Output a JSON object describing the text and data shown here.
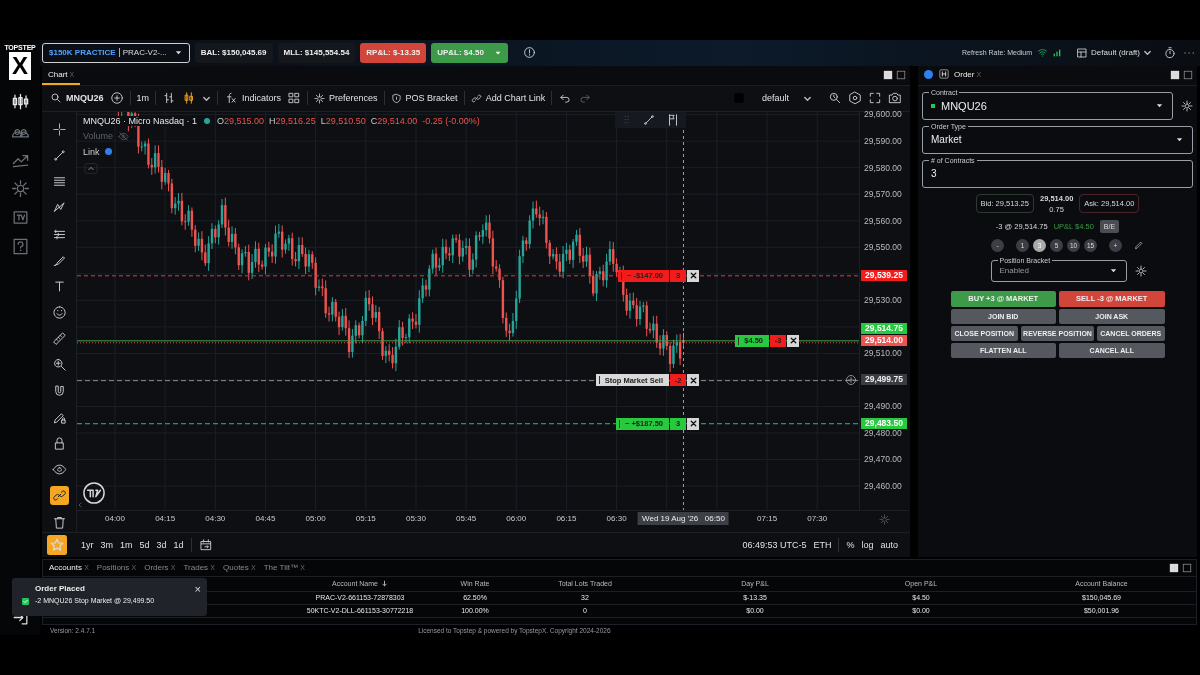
{
  "logo": {
    "wordmark": "TOPSTEP",
    "mark": "X"
  },
  "app_nav": [
    {
      "kind": "chart",
      "selected": true
    },
    {
      "kind": "people",
      "selected": false
    },
    {
      "kind": "trend",
      "selected": false
    },
    {
      "kind": "gear",
      "selected": false
    },
    {
      "kind": "tv",
      "selected": false
    },
    {
      "kind": "help",
      "selected": false
    }
  ],
  "header": {
    "account": {
      "name": "$150K PRACTICE",
      "id": "PRAC-V2-..."
    },
    "stats": [
      {
        "text": "BAL: $150,045.69",
        "kind": "neutral"
      },
      {
        "text": "MLL: $145,554.54",
        "kind": "neutral"
      },
      {
        "text": "RP&L: $-13.35",
        "kind": "loss"
      },
      {
        "text": "UP&L: $4.50",
        "kind": "gain"
      }
    ],
    "refresh_rate": "Refresh Rate: Medium",
    "layout": "Default (draft)"
  },
  "chart_panel": {
    "tab": {
      "label": "Chart",
      "close": "X"
    },
    "toolbar": {
      "symbol": "MNQU26",
      "interval": "1m",
      "indicators": "Indicators",
      "preferences": "Preferences",
      "pos_bracket": "POS Bracket",
      "chart_link": "Add Chart Link",
      "template": "default"
    },
    "legend": {
      "title": "MNQU26 · Micro Nasdaq · 1",
      "ohlc": [
        {
          "key": "O",
          "value": "29,515.00"
        },
        {
          "key": "H",
          "value": "29,516.25"
        },
        {
          "key": "L",
          "value": "29,510.50"
        },
        {
          "key": "C",
          "value": "29,514.00"
        }
      ],
      "change": "-0.25 (-0.00%)",
      "volume": "Volume",
      "link": "Link"
    },
    "tools": [
      {
        "kind": "cross",
        "selected": true,
        "on": false
      },
      {
        "kind": "line",
        "selected": false,
        "on": false
      },
      {
        "kind": "fib",
        "selected": false,
        "on": false
      },
      {
        "kind": "pattern",
        "selected": false,
        "on": false
      },
      {
        "kind": "list",
        "selected": false,
        "on": false
      },
      {
        "kind": "brush",
        "selected": false,
        "on": false
      },
      {
        "kind": "text",
        "selected": false,
        "on": false
      },
      {
        "kind": "emoji",
        "selected": false,
        "on": false
      },
      {
        "kind": "ruler",
        "selected": false,
        "on": false
      },
      {
        "kind": "zoom",
        "selected": false,
        "on": false
      },
      {
        "kind": "magnet",
        "selected": false,
        "on": false
      },
      {
        "kind": "pencil-lock",
        "selected": false,
        "on": false
      },
      {
        "kind": "lock",
        "selected": false,
        "on": false
      },
      {
        "kind": "eye",
        "selected": false,
        "on": false
      },
      {
        "kind": "link",
        "selected": false,
        "on": true
      },
      {
        "kind": "trash",
        "selected": false,
        "on": false
      }
    ],
    "price_ticks": [
      "29,600.00",
      "29,590.00",
      "29,580.00",
      "29,570.00",
      "29,560.00",
      "29,550.00",
      "29,530.00",
      "29,510.00",
      "29,490.00",
      "29,480.00",
      "29,470.00",
      "29,460.00"
    ],
    "time_axis": [
      {
        "text": "04:00",
        "kind": "tick"
      },
      {
        "text": "04:15",
        "kind": "tick"
      },
      {
        "text": "04:30",
        "kind": "tick"
      },
      {
        "text": "04:45",
        "kind": "tick"
      },
      {
        "text": "05:00",
        "kind": "tick"
      },
      {
        "text": "05:15",
        "kind": "tick"
      },
      {
        "text": "05:30",
        "kind": "tick"
      },
      {
        "text": "05:45",
        "kind": "tick"
      },
      {
        "text": "06:00",
        "kind": "tick"
      },
      {
        "text": "06:15",
        "kind": "tick"
      },
      {
        "text": "06:30",
        "kind": "tick"
      },
      {
        "text": "Wed 19 Aug '26   06:50",
        "kind": "crosshair"
      },
      {
        "text": "07:15",
        "kind": "tick"
      },
      {
        "text": "07:30",
        "kind": "tick"
      }
    ],
    "order_lines": [
      {
        "kind": "loss",
        "label": "~ -$147.00",
        "qty": "3",
        "price": "29,539.25"
      },
      {
        "kind": "position",
        "label": "$4.50",
        "qty": "-3",
        "price": "29,514.75"
      },
      {
        "kind": "stop",
        "label": "Stop Market Sell",
        "qty": "-2",
        "price": "29,499.75"
      },
      {
        "kind": "profit",
        "label": "~ +$187.50",
        "qty": "3",
        "price": "29,483.50"
      }
    ],
    "last_price": "29,514.00",
    "ranges": [
      "1yr",
      "3m",
      "1m",
      "5d",
      "3d",
      "1d"
    ],
    "clock": "06:49:53 UTC-5",
    "session": "ETH",
    "scale_options": [
      "%",
      "log",
      "auto"
    ]
  },
  "order_panel": {
    "tab": {
      "label": "Order",
      "close": "X"
    },
    "contract": {
      "label": "Contract",
      "value": "MNQU26"
    },
    "order_type": {
      "label": "Order Type",
      "value": "Market"
    },
    "contracts": {
      "label": "# of Contracts",
      "value": "3"
    },
    "bid": "Bid: 29,513.25",
    "last": "29,514.00",
    "spread": "0.75",
    "ask": "Ask: 29,514.00",
    "position": "-3 @ 29,514.75",
    "upl": "UP&L $4.50",
    "breakeven": "B/E",
    "minus": "-",
    "plus": "+",
    "quantity_presets": [
      {
        "text": "1",
        "selected": false
      },
      {
        "text": "3",
        "selected": true
      },
      {
        "text": "5",
        "selected": false
      },
      {
        "text": "10",
        "selected": false
      },
      {
        "text": "15",
        "selected": false
      }
    ],
    "bracket": {
      "label": "Position Bracket",
      "value": "Enabled"
    },
    "buy": "BUY +3 @ MARKET",
    "sell": "SELL -3 @ MARKET",
    "actions": [
      [
        "JOIN BID",
        "JOIN ASK"
      ],
      [
        "CLOSE POSITION",
        "REVERSE POSITION",
        "CANCEL ORDERS"
      ],
      [
        "FLATTEN ALL",
        "CANCEL ALL"
      ]
    ]
  },
  "bottom_panel": {
    "tabs": [
      {
        "label": "Accounts",
        "close": "X",
        "selected": true
      },
      {
        "label": "Positions",
        "close": "X",
        "selected": false
      },
      {
        "label": "Orders",
        "close": "X",
        "selected": false
      },
      {
        "label": "Trades",
        "close": "X",
        "selected": false
      },
      {
        "label": "Quotes",
        "close": "X",
        "selected": false
      },
      {
        "label": "The Tilt™",
        "close": "X",
        "selected": false
      }
    ],
    "columns": [
      "Account Name",
      "Win Rate",
      "Total Lots Traded",
      "Day P&L",
      "Open P&L",
      "Account Balance"
    ],
    "rows": [
      [
        "PRAC-V2-661153-72878303",
        "62.50%",
        "32",
        "$-13.35",
        "$4.50",
        "$150,045.69"
      ],
      [
        "50KTC-V2-DLL-661153-30772218",
        "100.00%",
        "0",
        "$0.00",
        "$0.00",
        "$50,001.96"
      ]
    ]
  },
  "toast": {
    "title": "Order Placed",
    "message": "-2 MNQU26 Stop Market @ 29,499.50",
    "close": "×"
  },
  "footer": {
    "version": "Version: 2.4.7.1",
    "license": "Licensed to Topstep & powered by TopstepX. Copyright 2024-2026"
  }
}
